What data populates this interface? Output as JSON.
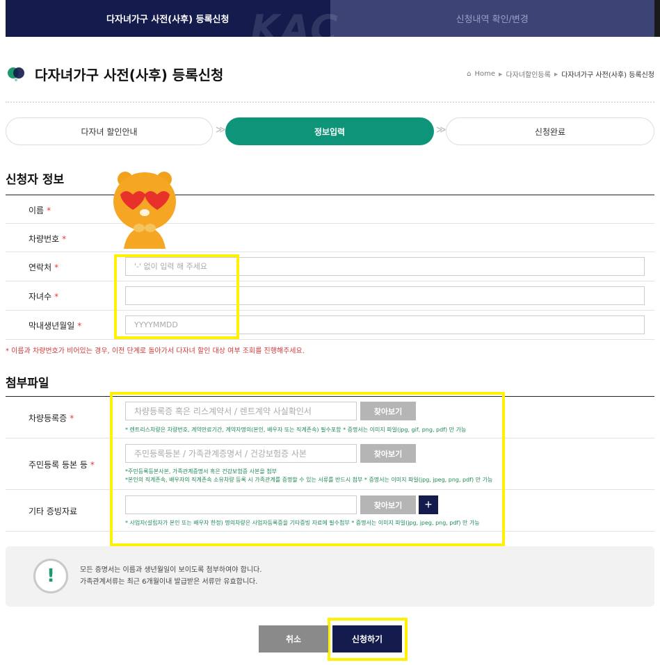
{
  "top_tabs": [
    {
      "label": "다자녀가구 사전(사후) 등록신청"
    },
    {
      "label": "신청내역 확인/변경"
    }
  ],
  "watermark": "KAC",
  "header": {
    "title": "다자녀가구 사전(사후) 등록신청",
    "breadcrumb": [
      "Home",
      "다자녀할인등록",
      "다자녀가구 사전(사후) 등록신청"
    ]
  },
  "steps": [
    "다자녀 할인안내",
    "정보입력",
    "신청완료"
  ],
  "applicant": {
    "section_title": "신청자 정보",
    "fields": [
      {
        "label": "이름",
        "value": "",
        "placeholder": ""
      },
      {
        "label": "차량번호",
        "value": "",
        "placeholder": ""
      },
      {
        "label": "연락처",
        "value": "",
        "placeholder": "'-' 없이 입력 해 주세요"
      },
      {
        "label": "자녀수",
        "value": "",
        "placeholder": ""
      },
      {
        "label": "막내생년월일",
        "value": "",
        "placeholder": "YYYYMMDD"
      }
    ],
    "warning": "* 이름과 차량번호가 비어있는 경우, 이전 단계로 돌아가서 다자녀 할인 대상 여부 조회를 진행해주세요."
  },
  "attachments": {
    "section_title": "첨부파일",
    "browse_label": "찾아보기",
    "plus_label": "+",
    "rows": [
      {
        "label": "차량등록증",
        "required": true,
        "placeholder": "차량등록증 혹은 리스계약서 / 렌트계약 사실확인서",
        "hints": [
          "* 렌트리스차량은 차량번호, 계약만료기간, 계약자명의(본인, 배우자 또는 직계존속) 필수포함   * 증명서는 이미지 파일(jpg, gif, png, pdf) 만 가능"
        ]
      },
      {
        "label": "주민등록 등본 등",
        "required": true,
        "placeholder": "주민등록등본 / 가족관계증명서 / 건강보험증 사본",
        "hints": [
          "*주민등록등본사본, 가족관계증명서 혹은 건강보험증 사본을 첨부",
          "*본인의 직계존속, 배우자의 직계존속 소유차량 등록 시 가족관계를 증명할 수 있는 서류를 반드시 첨부   * 증명서는 이미지 파일(jpg, jpeg, png, pdf) 만 가능"
        ]
      },
      {
        "label": "기타 증빙자료",
        "required": false,
        "placeholder": "",
        "hints": [
          "* 사업자(설립자가 본인 또는 배우자 한정) 명의차량은 사업자등록증을 기타증빙 자료에 필수첨부   * 증명서는 이미지 파일(jpg, jpeg, png, pdf) 만 가능"
        ]
      }
    ]
  },
  "notice": [
    "모든 증명서는 이름과 생년월일이 보이도록 첨부하여야 합니다.",
    "가족관계서류는 최근 6개월이내 발급받은 서류만 유효합니다."
  ],
  "notice_icon": "!",
  "buttons": {
    "cancel": "취소",
    "submit": "신청하기"
  },
  "colors": {
    "navy": "#141b4d",
    "green": "#0d9479",
    "highlight": "#fff200",
    "required": "#e23b3b"
  }
}
